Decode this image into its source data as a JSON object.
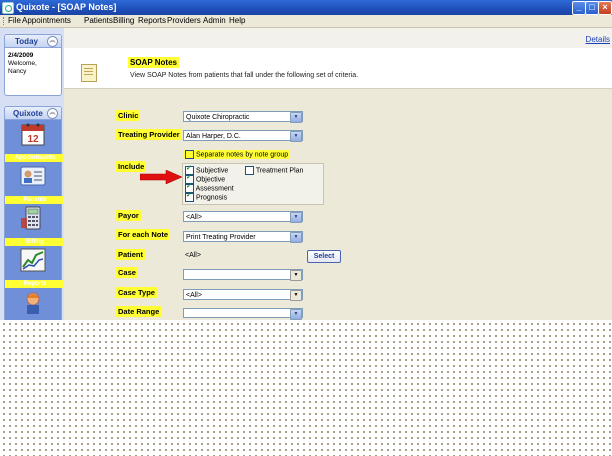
{
  "window": {
    "title": "Quixote - [SOAP Notes]"
  },
  "menu": [
    "File",
    "Appointments",
    "Patients",
    "Billing",
    "Reports",
    "Providers",
    "Admin",
    "Help"
  ],
  "details_link": "Details",
  "sidebar": {
    "today": {
      "title": "Today",
      "date": "2/4/2009",
      "welcome": "Welcome,",
      "user": "Nancy"
    },
    "nav": {
      "title": "Quixote",
      "items": [
        {
          "label": "Appointments",
          "icon": "calendar-icon"
        },
        {
          "label": "Patients",
          "icon": "patient-card-icon"
        },
        {
          "label": "Billing",
          "icon": "calculator-icon"
        },
        {
          "label": "Reports",
          "icon": "chart-icon"
        },
        {
          "label": "",
          "icon": "provider-person-icon"
        }
      ]
    }
  },
  "header": {
    "title": "SOAP Notes",
    "description": "View SOAP Notes from patients that fall under the following set of criteria."
  },
  "form": {
    "clinic": {
      "label": "Clinic",
      "value": "Quixote Chiropractic"
    },
    "treating_provider": {
      "label": "Treating Provider",
      "value": "Alan Harper, D.C."
    },
    "separate_notes": {
      "label": "Separate notes by note group",
      "checked": false
    },
    "include": {
      "label": "Include",
      "options": [
        {
          "label": "Subjective",
          "checked": true
        },
        {
          "label": "Treatment Plan",
          "checked": false
        },
        {
          "label": "Objective",
          "checked": true
        },
        {
          "label": "Assessment",
          "checked": true
        },
        {
          "label": "Prognosis",
          "checked": true
        }
      ]
    },
    "payor": {
      "label": "Payor",
      "value": "<All>"
    },
    "for_each_note": {
      "label": "For each Note",
      "value": "Print Treating Provider"
    },
    "patient": {
      "label": "Patient",
      "value": "<All>",
      "button": "Select"
    },
    "case": {
      "label": "Case",
      "value": ""
    },
    "case_type": {
      "label": "Case Type",
      "value": "<All>"
    },
    "date_range": {
      "label": "Date Range"
    }
  },
  "colors": {
    "highlight": "#ffff33",
    "title_bar": "#1f4fb8",
    "arrow": "#e01010",
    "sidebar": "#6f8fd8"
  }
}
